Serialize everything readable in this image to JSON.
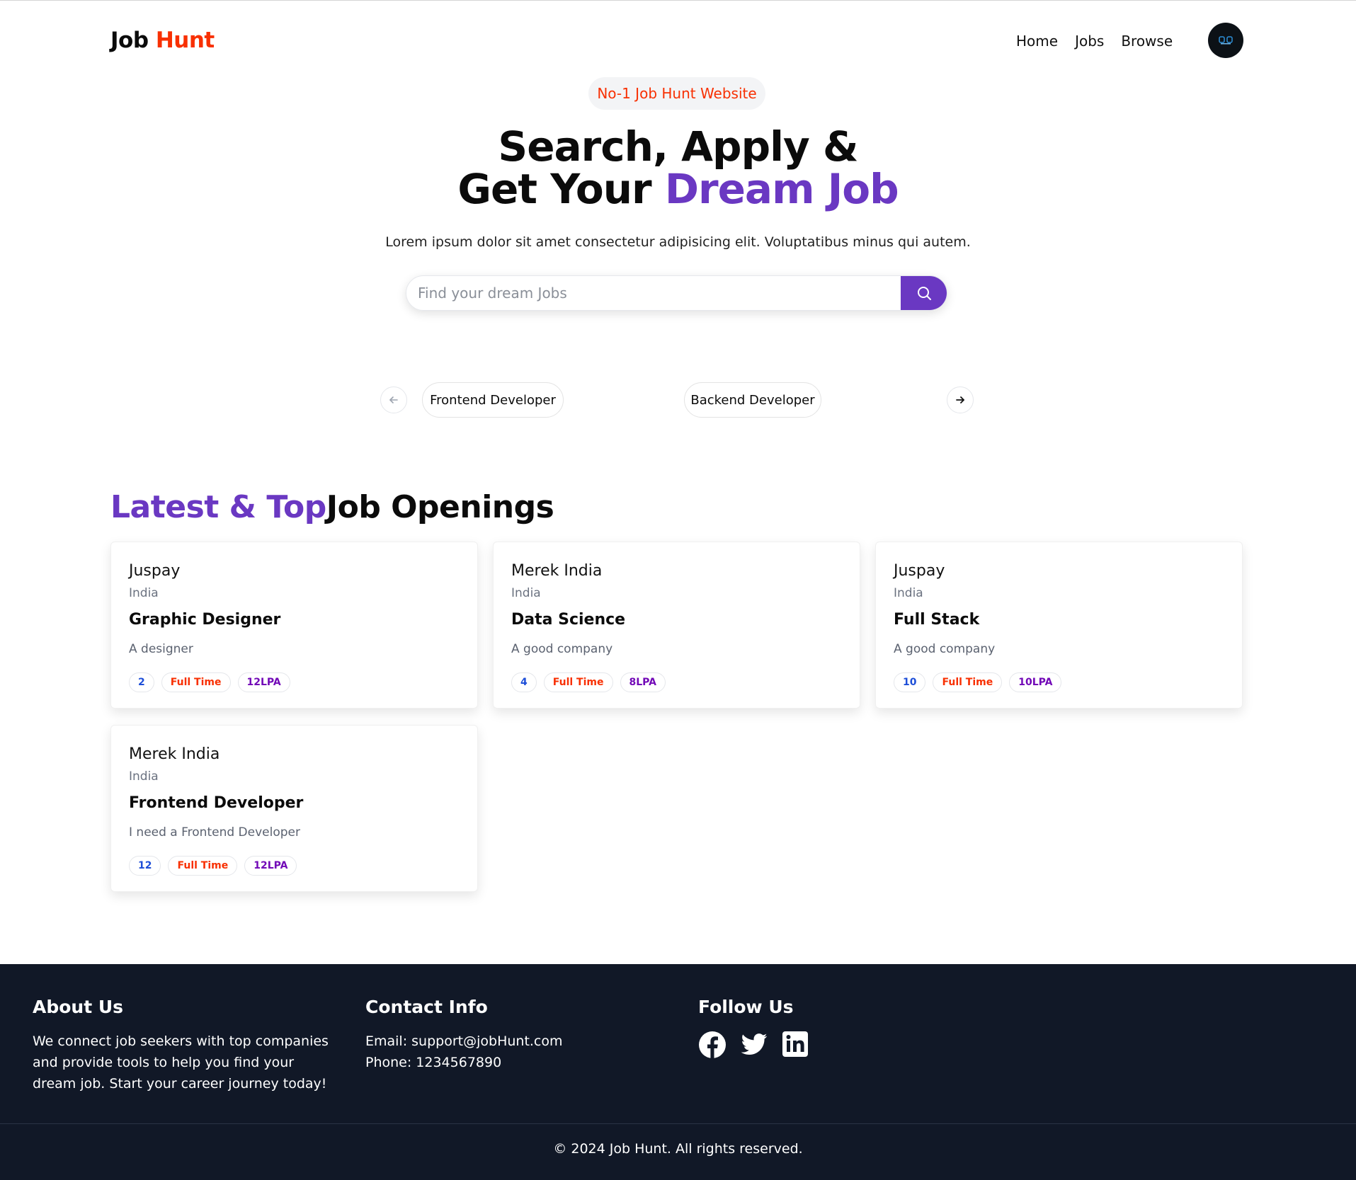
{
  "navbar": {
    "logo_part1": "Job",
    "logo_part2": "Hunt",
    "links": [
      "Home",
      "Jobs",
      "Browse"
    ],
    "avatar_icon": "user-avatar"
  },
  "hero": {
    "badge": "No-1 Job Hunt Website",
    "title_line1": "Search, Apply &",
    "title_line2_prefix": "Get Your",
    "title_line2_highlight": "Dream Job",
    "subtitle": "Lorem ipsum dolor sit amet consectetur adipisicing elit. Voluptatibus minus qui autem.",
    "search_placeholder": "Find your dream Jobs",
    "search_icon": "search-icon"
  },
  "categories": {
    "items": [
      "Frontend Developer",
      "Backend Developer"
    ],
    "prev_icon": "arrow-left-icon",
    "next_icon": "arrow-right-icon"
  },
  "section": {
    "title_highlight": "Latest & Top",
    "title_rest": "Job Openings"
  },
  "jobs": [
    {
      "company": "Juspay",
      "location": "India",
      "title": "Graphic Designer",
      "description": "A designer",
      "positions": "2",
      "type": "Full Time",
      "salary": "12LPA"
    },
    {
      "company": "Merek India",
      "location": "India",
      "title": "Data Science",
      "description": "A good company",
      "positions": "4",
      "type": "Full Time",
      "salary": "8LPA"
    },
    {
      "company": "Juspay",
      "location": "India",
      "title": "Full Stack",
      "description": "A good company",
      "positions": "10",
      "type": "Full Time",
      "salary": "10LPA"
    },
    {
      "company": "Merek India",
      "location": "India",
      "title": "Frontend Developer",
      "description": "I need a Frontend Developer",
      "positions": "12",
      "type": "Full Time",
      "salary": "12LPA"
    }
  ],
  "footer": {
    "about_title": "About Us",
    "about_text": "We connect job seekers with top companies and provide tools to help you find your dream job. Start your career journey today!",
    "contact_title": "Contact Info",
    "email": "Email: support@jobHunt.com",
    "phone": "Phone: 1234567890",
    "follow_title": "Follow Us",
    "social_icons": [
      "facebook-icon",
      "twitter-icon",
      "linkedin-icon"
    ],
    "copyright": "© 2024 Job Hunt. All rights reserved."
  },
  "colors": {
    "accent_purple": "#6a38c2",
    "accent_red": "#f83002",
    "footer_bg": "#111827"
  }
}
